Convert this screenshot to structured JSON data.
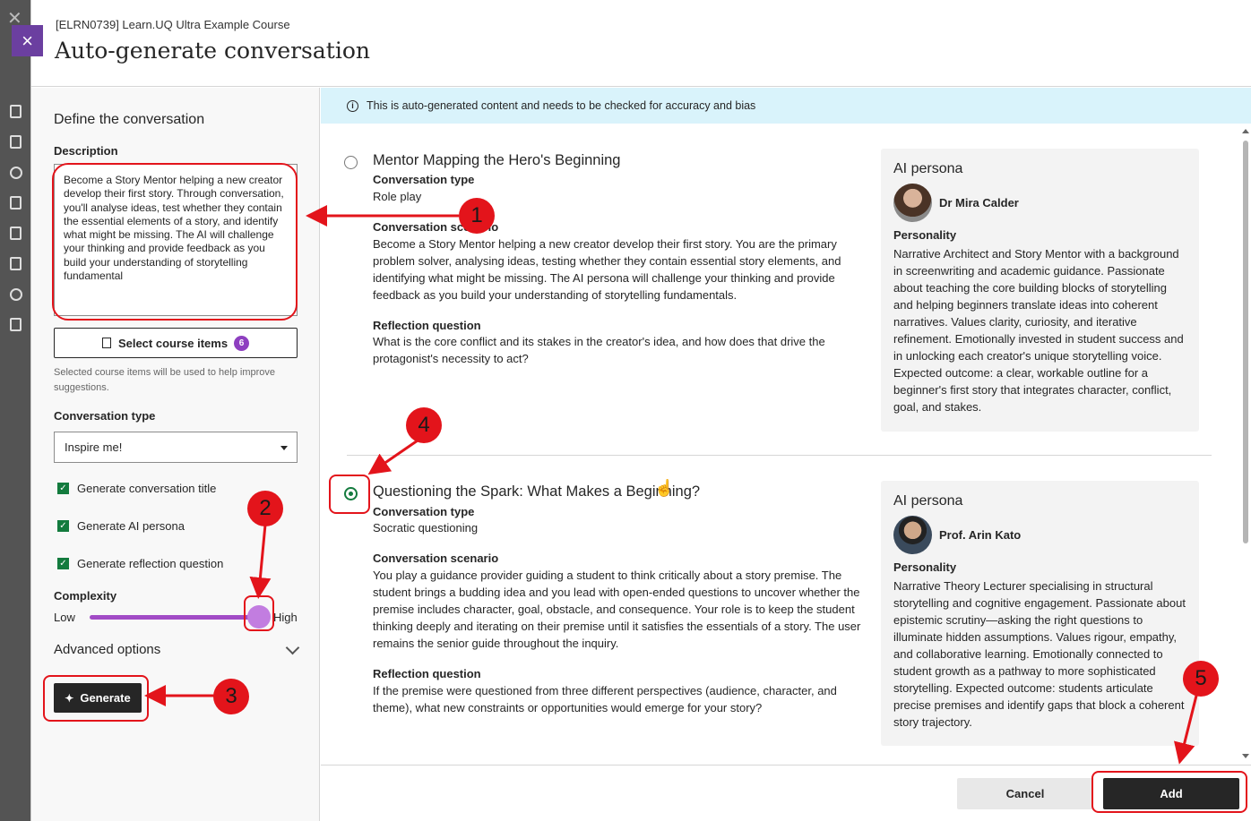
{
  "header": {
    "course": "[ELRN0739] Learn.UQ Ultra Example Course",
    "title": "Auto-generate conversation",
    "close_icon": "×"
  },
  "sidebar": {
    "heading": "Define the conversation",
    "description_label": "Description",
    "description_value": "Become a Story Mentor helping a new creator develop their first story. Through conversation, you'll analyse ideas, test whether they contain the essential elements of a story, and identify what might be missing. The AI will challenge your thinking and provide feedback as you build your understanding of storytelling fundamental",
    "select_items_label": "Select course items",
    "select_items_count": "6",
    "select_items_hint": "Selected course items will be used to help improve suggestions.",
    "conversation_type_label": "Conversation type",
    "conversation_type_value": "Inspire me!",
    "checks": [
      {
        "label": "Generate conversation title",
        "checked": true
      },
      {
        "label": "Generate AI persona",
        "checked": true
      },
      {
        "label": "Generate reflection question",
        "checked": true
      }
    ],
    "complexity_label": "Complexity",
    "complexity_low": "Low",
    "complexity_high": "High",
    "complexity_level": 1.0,
    "advanced_label": "Advanced options",
    "generate_label": "Generate"
  },
  "banner": {
    "text": "This is auto-generated content and needs to be checked for accuracy and bias"
  },
  "results": [
    {
      "selected": false,
      "title": "Mentor Mapping the Hero's Beginning",
      "type_label": "Conversation type",
      "type_value": "Role play",
      "scenario_label": "Conversation scenario",
      "scenario": "Become a Story Mentor helping a new creator develop their first story. You are the primary problem solver, analysing ideas, testing whether they contain essential story elements, and identifying what might be missing. The AI persona will challenge your thinking and provide feedback as you build your understanding of storytelling fundamentals.",
      "reflection_label": "Reflection question",
      "reflection": "What is the core conflict and its stakes in the creator's idea, and how does that drive the protagonist's necessity to act?",
      "persona": {
        "heading": "AI persona",
        "name": "Dr Mira Calder",
        "personality_label": "Personality",
        "personality": "Narrative Architect and Story Mentor with a background in screenwriting and academic guidance. Passionate about teaching the core building blocks of storytelling and helping beginners translate ideas into coherent narratives. Values clarity, curiosity, and iterative refinement. Emotionally invested in student success and in unlocking each creator's unique storytelling voice. Expected outcome: a clear, workable outline for a beginner's first story that integrates character, conflict, goal, and stakes."
      }
    },
    {
      "selected": true,
      "title": "Questioning the Spark: What Makes a Beginning?",
      "type_label": "Conversation type",
      "type_value": "Socratic questioning",
      "scenario_label": "Conversation scenario",
      "scenario": "You play a guidance provider guiding a student to think critically about a story premise. The student brings a budding idea and you lead with open-ended questions to uncover whether the premise includes character, goal, obstacle, and consequence. Your role is to keep the student thinking deeply and iterating on their premise until it satisfies the essentials of a story. The user remains the senior guide throughout the inquiry.",
      "reflection_label": "Reflection question",
      "reflection": "If the premise were questioned from three different perspectives (audience, character, and theme), what new constraints or opportunities would emerge for your story?",
      "persona": {
        "heading": "AI persona",
        "name": "Prof. Arin Kato",
        "personality_label": "Personality",
        "personality": "Narrative Theory Lecturer specialising in structural storytelling and cognitive engagement. Passionate about epistemic scrutiny—asking the right questions to illuminate hidden assumptions. Values rigour, empathy, and collaborative learning. Emotionally connected to student growth as a pathway to more sophisticated storytelling. Expected outcome: students articulate precise premises and identify gaps that block a coherent story trajectory."
      }
    }
  ],
  "footer": {
    "cancel_label": "Cancel",
    "add_label": "Add"
  },
  "annotations": [
    "1",
    "2",
    "3",
    "4",
    "5"
  ],
  "colors": {
    "accent": "#6b3fa0",
    "check": "#137b3e",
    "slider": "#a24bc6",
    "annotation": "#e3141b",
    "banner": "#d9f3fb"
  }
}
